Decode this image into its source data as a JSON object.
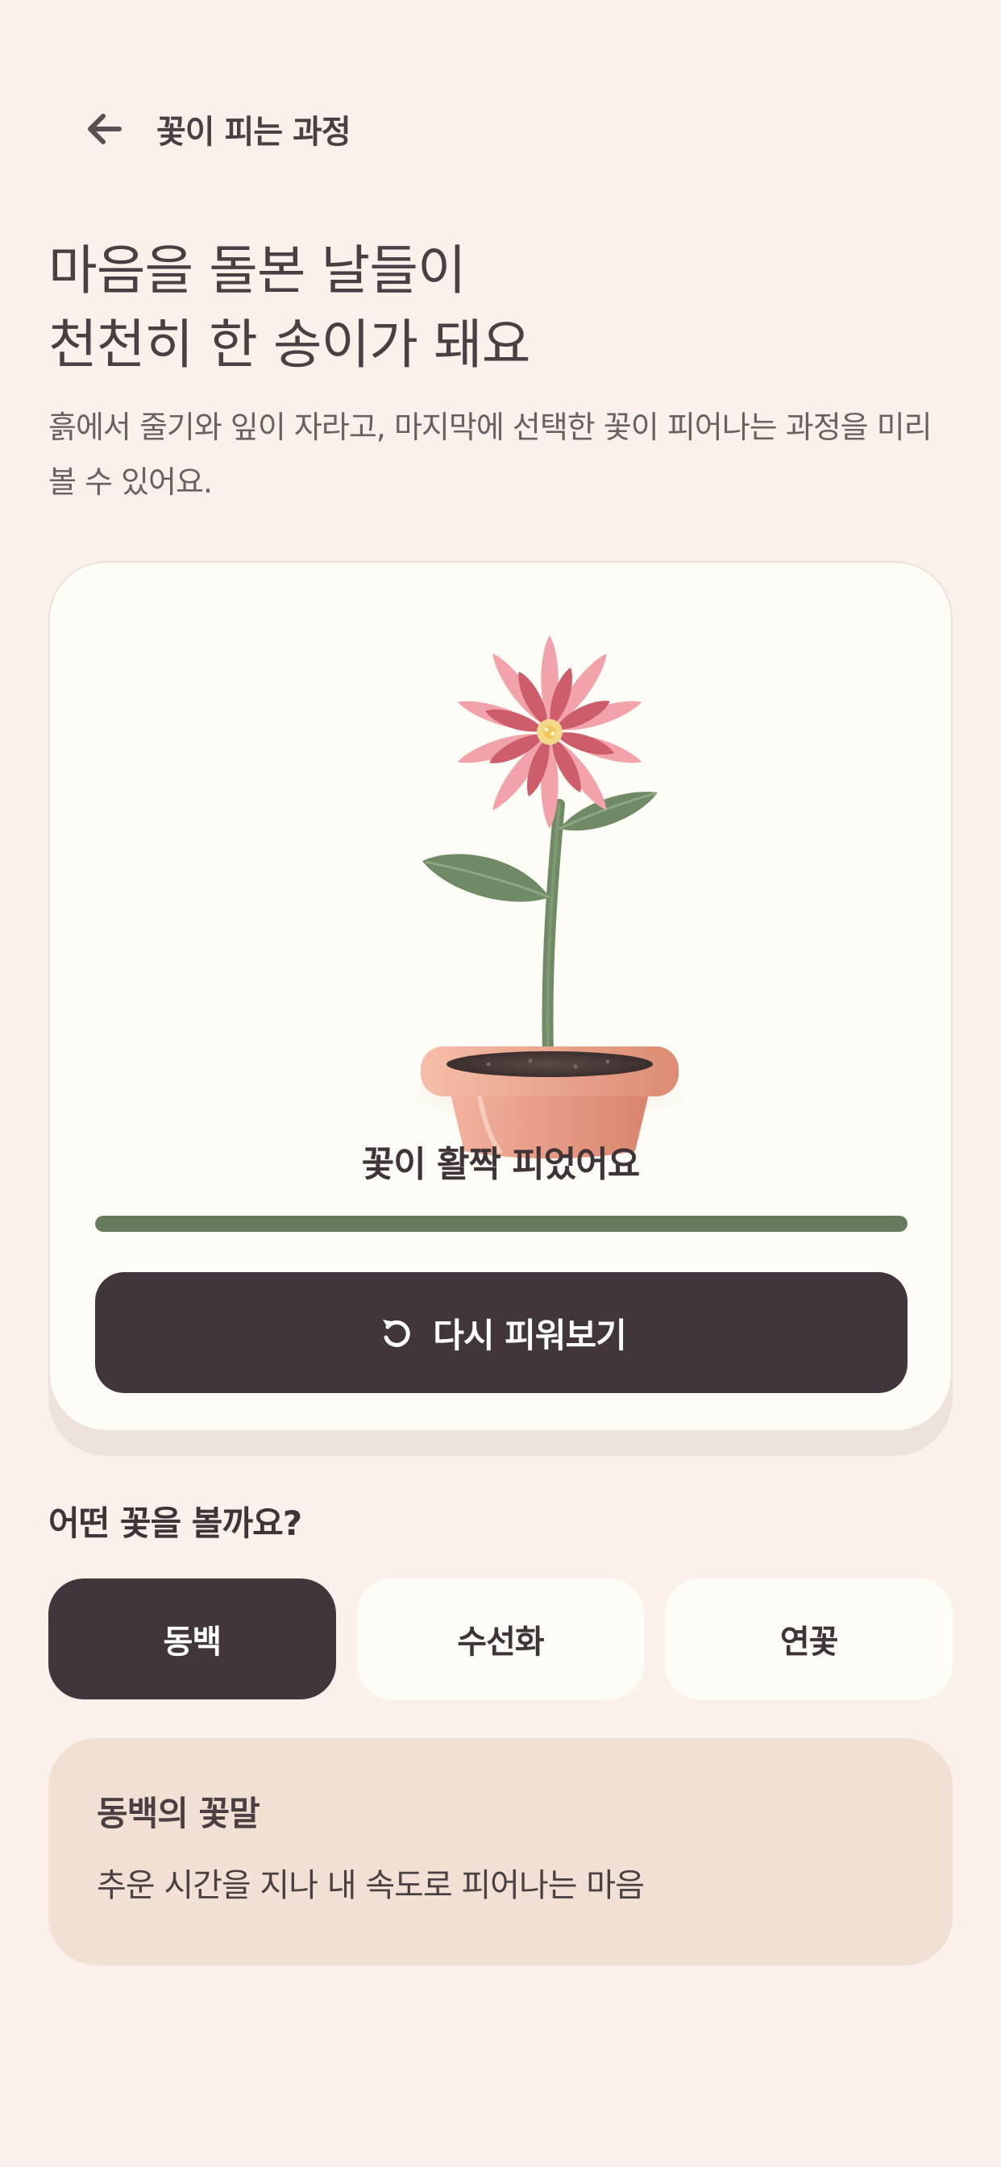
{
  "header": {
    "title": "꽃이 피는 과정",
    "back_icon": "arrow-left-icon"
  },
  "intro": {
    "headline_line1": "마음을 돌본 날들이",
    "headline_line2": "천천히 한 송이가 돼요",
    "description": "흙에서 줄기와 잎이 자라고, 마지막에 선택한 꽃이 피어나는 과정을 미리 볼 수 있어요."
  },
  "growth": {
    "status": "꽃이 활짝 피었어요",
    "progress": 1.0,
    "replay_label": "다시 피워보기",
    "replay_icon": "replay-icon"
  },
  "picker": {
    "title": "어떤 꽃을 볼까요?",
    "options": [
      {
        "label": "동백",
        "selected": true
      },
      {
        "label": "수선화",
        "selected": false
      },
      {
        "label": "연꽃",
        "selected": false
      }
    ]
  },
  "meaning": {
    "title": "동백의 꽃말",
    "text": "추운 시간을 지나 내 속도로 피어나는 마음"
  },
  "colors": {
    "background": "#f9f1ea",
    "card": "#fefcf6",
    "primary_dark": "#41363c",
    "progress": "#667a5e",
    "petal_light": "#f2a2aa",
    "petal_dark": "#cd5d6b",
    "pot": "#e4987c",
    "leaf": "#6f8a64",
    "meaning_bg": "#f3e0d4"
  }
}
